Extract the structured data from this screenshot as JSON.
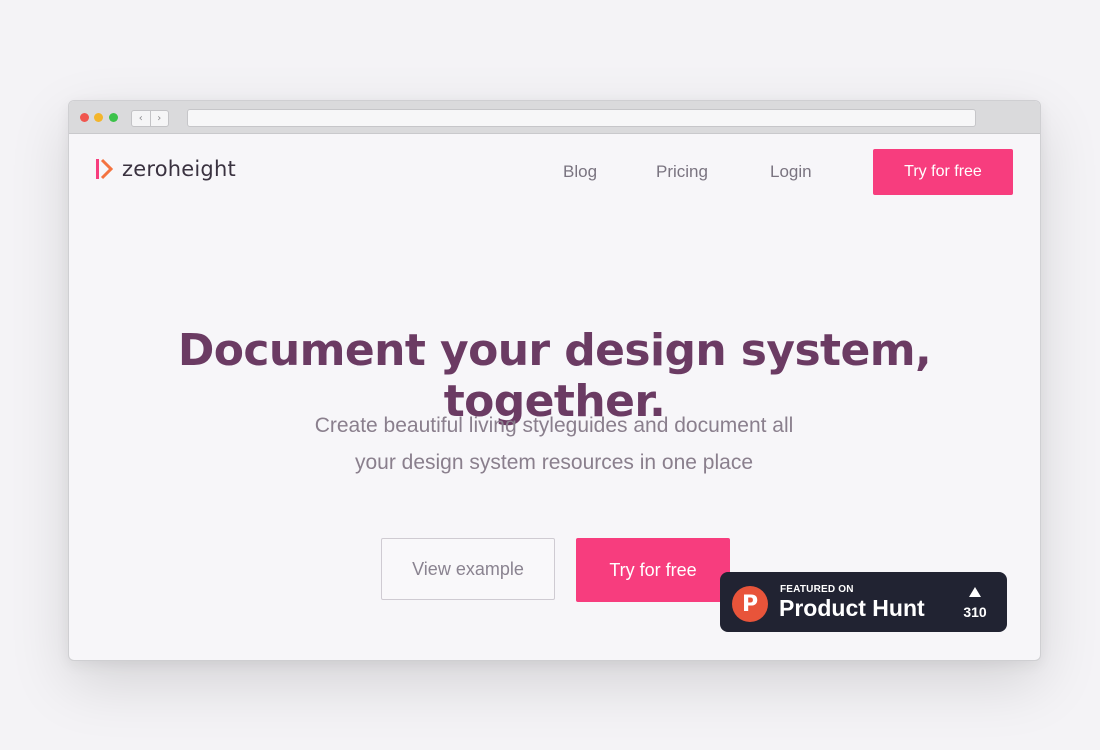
{
  "brand": {
    "name": "zeroheight",
    "accent": "#f73d7e",
    "title_color": "#6b3b63"
  },
  "nav": {
    "links": [
      "Blog",
      "Pricing",
      "Login"
    ],
    "cta": "Try for free"
  },
  "hero": {
    "title": "Document your design system, together.",
    "subtitle": "Create beautiful living styleguides and document all your design system resources in one place",
    "secondary_button": "View example",
    "primary_button": "Try for free"
  },
  "product_hunt": {
    "featured": "FEATURED ON",
    "name": "Product Hunt",
    "logo_letter": "P",
    "votes": "310"
  },
  "browser": {
    "back_icon": "chevron-left-icon",
    "forward_icon": "chevron-right-icon"
  }
}
